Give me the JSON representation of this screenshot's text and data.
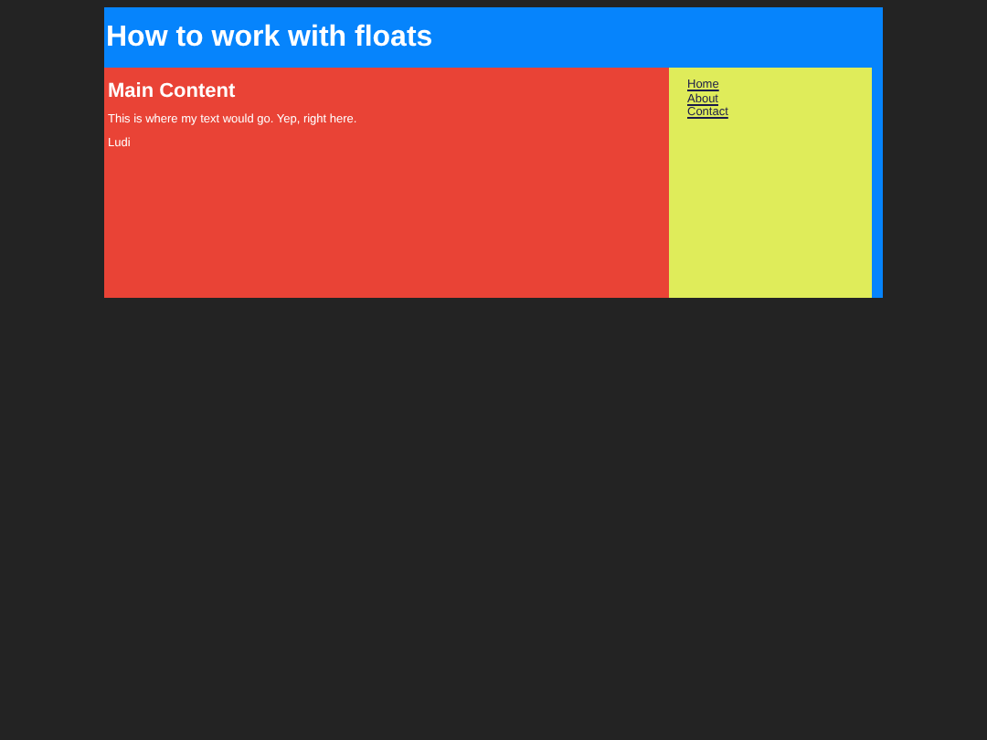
{
  "header": {
    "title": "How to work with floats"
  },
  "main": {
    "heading": "Main Content",
    "paragraphs": [
      "This is where my text would go. Yep, right here.",
      "Ludi"
    ]
  },
  "sidebar": {
    "links": [
      "Home",
      "About",
      "Contact"
    ]
  }
}
